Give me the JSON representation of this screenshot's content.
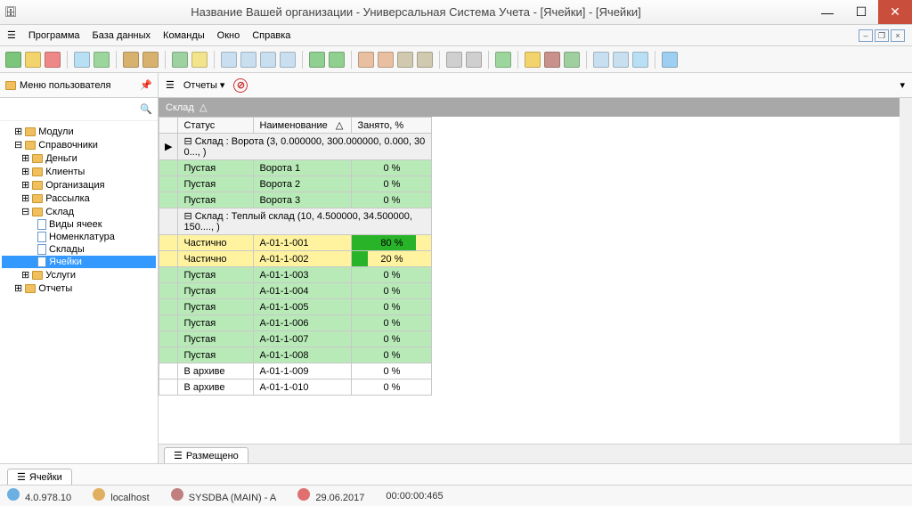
{
  "window": {
    "title": "Название Вашей организации - Универсальная Система Учета - [Ячейки] - [Ячейки]"
  },
  "menu": {
    "items": [
      "Программа",
      "База данных",
      "Команды",
      "Окно",
      "Справка"
    ]
  },
  "leftpane": {
    "title": "Меню пользователя"
  },
  "tree": {
    "modules": "Модули",
    "spravochniki": "Справочники",
    "dengi": "Деньги",
    "klienty": "Клиенты",
    "org": "Организация",
    "rassylka": "Рассылка",
    "sklad": "Склад",
    "vidy": "Виды ячеек",
    "nomen": "Номенклатура",
    "sklady": "Склады",
    "yacheyki": "Ячейки",
    "uslugi": "Услуги",
    "otchety": "Отчеты"
  },
  "toolbar2": {
    "reports": "Отчеты"
  },
  "grid": {
    "group_by": "Склад",
    "columns": {
      "status": "Статус",
      "name": "Наименование",
      "occ": "Занято, %"
    },
    "groups": [
      {
        "title": "Склад : Ворота (3, 0.000000, 300.000000, 0.000, 30 0..., )",
        "rows": [
          {
            "status": "Пустая",
            "name": "Ворота 1",
            "occ": 0,
            "cls": "empty"
          },
          {
            "status": "Пустая",
            "name": "Ворота 2",
            "occ": 0,
            "cls": "empty"
          },
          {
            "status": "Пустая",
            "name": "Ворота 3",
            "occ": 0,
            "cls": "empty"
          }
        ]
      },
      {
        "title": "Склад : Теплый склад (10, 4.500000, 34.500000, 150...., )",
        "rows": [
          {
            "status": "Частично",
            "name": "A-01-1-001",
            "occ": 80,
            "cls": "partial"
          },
          {
            "status": "Частично",
            "name": "A-01-1-002",
            "occ": 20,
            "cls": "partial"
          },
          {
            "status": "Пустая",
            "name": "A-01-1-003",
            "occ": 0,
            "cls": "empty"
          },
          {
            "status": "Пустая",
            "name": "A-01-1-004",
            "occ": 0,
            "cls": "empty"
          },
          {
            "status": "Пустая",
            "name": "A-01-1-005",
            "occ": 0,
            "cls": "empty"
          },
          {
            "status": "Пустая",
            "name": "A-01-1-006",
            "occ": 0,
            "cls": "empty"
          },
          {
            "status": "Пустая",
            "name": "A-01-1-007",
            "occ": 0,
            "cls": "empty"
          },
          {
            "status": "Пустая",
            "name": "A-01-1-008",
            "occ": 0,
            "cls": "empty"
          },
          {
            "status": "В архиве",
            "name": "A-01-1-009",
            "occ": 0,
            "cls": "archive"
          },
          {
            "status": "В архиве",
            "name": "A-01-1-010",
            "occ": 0,
            "cls": "archive"
          }
        ]
      }
    ]
  },
  "bottom_tab": "Размещено",
  "doc_tab": "Ячейки",
  "status": {
    "ver": "4.0.978.10",
    "host": "localhost",
    "user": "SYSDBA (MAIN) - A",
    "date": "29.06.2017",
    "time": "00:00:00:465"
  },
  "icons": {
    "toolbar1": [
      {
        "name": "new",
        "bg": "#7cc67c"
      },
      {
        "name": "open",
        "bg": "#f3d36b"
      },
      {
        "name": "delete",
        "bg": "#e88"
      },
      {
        "sep": 1
      },
      {
        "name": "search",
        "bg": "#b8dff3"
      },
      {
        "name": "refresh",
        "bg": "#9cd69c"
      },
      {
        "sep": 1
      },
      {
        "name": "filter",
        "bg": "#d7b26e"
      },
      {
        "name": "filter2",
        "bg": "#d7b26e"
      },
      {
        "sep": 1
      },
      {
        "name": "grid1",
        "bg": "#9ed1a0"
      },
      {
        "name": "grid2",
        "bg": "#f3e38b"
      },
      {
        "sep": 1
      },
      {
        "name": "b1",
        "bg": "#c9dff0"
      },
      {
        "name": "b2",
        "bg": "#c9dff0"
      },
      {
        "name": "b3",
        "bg": "#c9dff0"
      },
      {
        "name": "b4",
        "bg": "#c9dff0"
      },
      {
        "sep": 1
      },
      {
        "name": "excel",
        "bg": "#8fcf8f"
      },
      {
        "name": "excel2",
        "bg": "#8fcf8f"
      },
      {
        "sep": 1
      },
      {
        "name": "c1",
        "bg": "#e8bfa0"
      },
      {
        "name": "c2",
        "bg": "#e8bfa0"
      },
      {
        "name": "c3",
        "bg": "#d0c9b0"
      },
      {
        "name": "c4",
        "bg": "#d0c9b0"
      },
      {
        "sep": 1
      },
      {
        "name": "tools",
        "bg": "#cfcfcf"
      },
      {
        "name": "cfg",
        "bg": "#cfcfcf"
      },
      {
        "sep": 1
      },
      {
        "name": "ok",
        "bg": "#9cd69c"
      },
      {
        "sep": 1
      },
      {
        "name": "lock",
        "bg": "#f3d36b"
      },
      {
        "name": "users",
        "bg": "#c8928a"
      },
      {
        "name": "db",
        "bg": "#9fcf9f"
      },
      {
        "sep": 1
      },
      {
        "name": "print",
        "bg": "#c8dff0"
      },
      {
        "name": "export",
        "bg": "#c8dff0"
      },
      {
        "name": "send",
        "bg": "#b8dff3"
      },
      {
        "sep": 1
      },
      {
        "name": "info",
        "bg": "#9fcff0"
      }
    ]
  }
}
